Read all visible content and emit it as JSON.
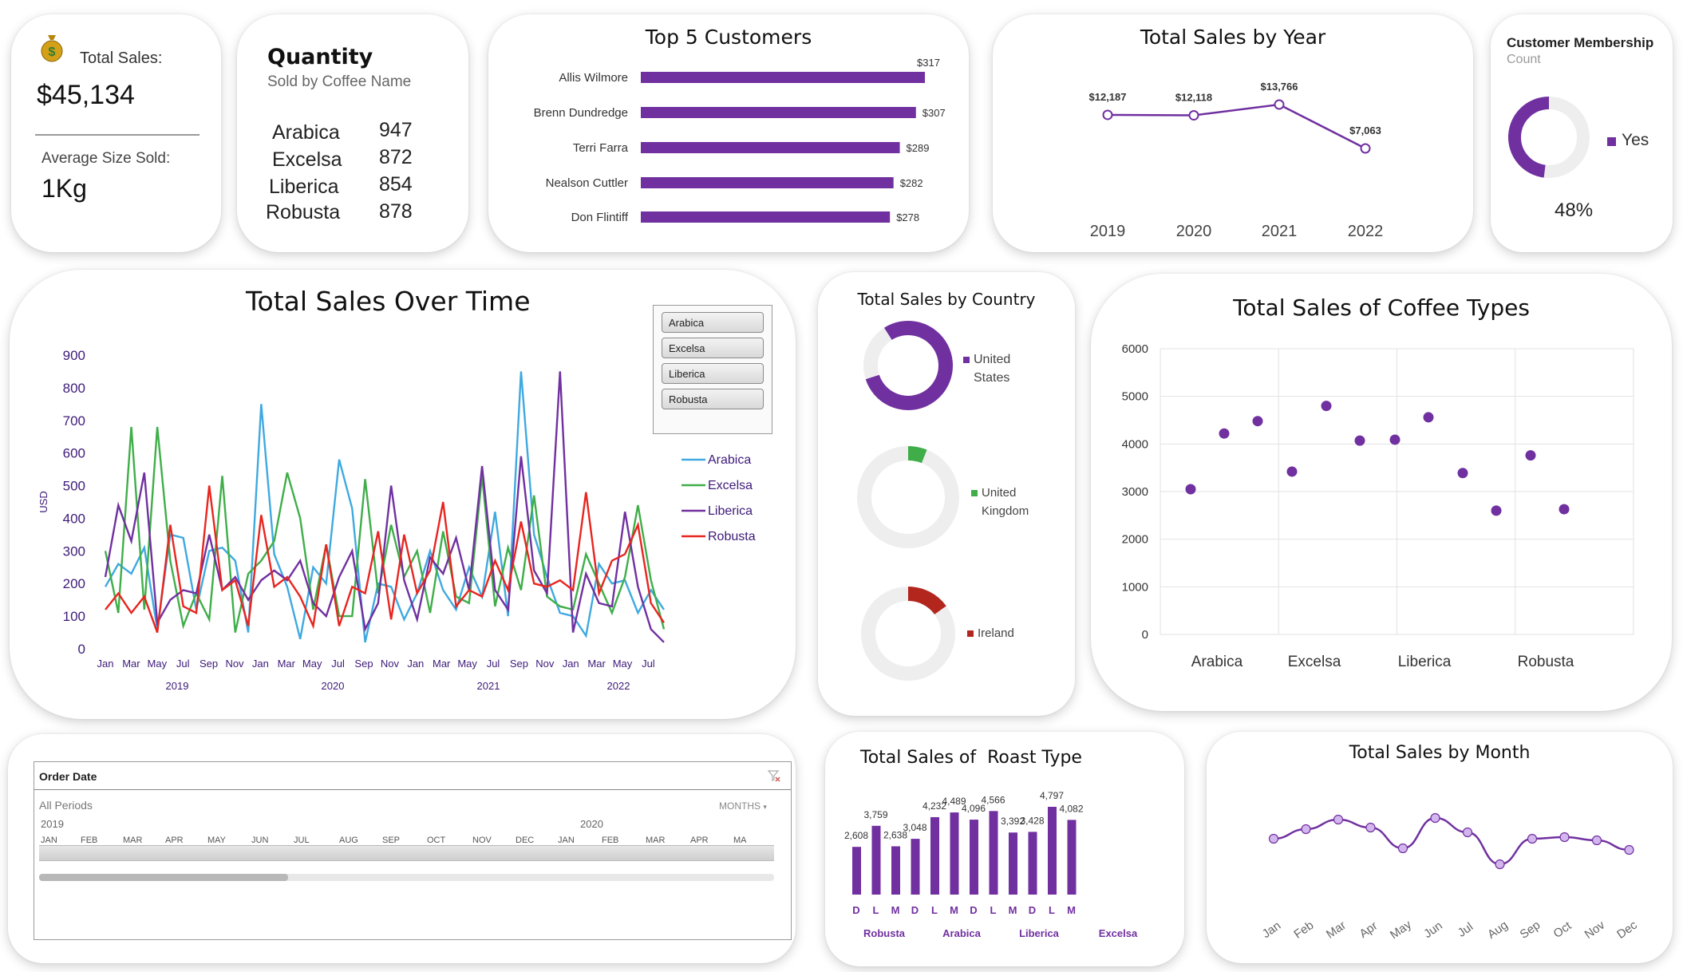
{
  "kpi": {
    "total_sales_label": "Total Sales:",
    "total_sales_value": "$45,134",
    "avg_size_label": "Average Size Sold:",
    "avg_size_value": "1Kg",
    "money_icon": "money-bag-icon"
  },
  "quantity": {
    "title": "Quantity",
    "subtitle": "Sold by Coffee Name",
    "rows": [
      {
        "name": "Arabica",
        "qty": "947"
      },
      {
        "name": "Excelsa",
        "qty": "872"
      },
      {
        "name": "Liberica",
        "qty": "854"
      },
      {
        "name": "Robusta",
        "qty": "878"
      }
    ]
  },
  "top_customers": {
    "title": "Top 5 Customers",
    "rows": [
      {
        "name": "Allis Wilmore",
        "label": "$317",
        "value": 317
      },
      {
        "name": "Brenn Dundredge",
        "label": "$307",
        "value": 307
      },
      {
        "name": "Terri Farra",
        "label": "$289",
        "value": 289
      },
      {
        "name": "Nealson Cuttler",
        "label": "$282",
        "value": 282
      },
      {
        "name": "Don Flintiff",
        "label": "$278",
        "value": 278
      }
    ]
  },
  "sales_by_year": {
    "title": "Total Sales by Year",
    "points": [
      {
        "year": "2019",
        "label": "$12,187",
        "value": 12187
      },
      {
        "year": "2020",
        "label": "$12,118",
        "value": 12118
      },
      {
        "year": "2021",
        "label": "$13,766",
        "value": 13766
      },
      {
        "year": "2022",
        "label": "$7,063",
        "value": 7063
      }
    ]
  },
  "membership": {
    "title": "Customer Membership",
    "subtitle": "Count",
    "legend": "Yes",
    "percent_label": "48%",
    "fraction": 0.48
  },
  "over_time": {
    "title": "Total Sales Over Time",
    "ylabel": "USD",
    "yticks": [
      "900",
      "800",
      "700",
      "600",
      "500",
      "400",
      "300",
      "200",
      "100",
      "0"
    ],
    "months": [
      "Jan",
      "Mar",
      "May",
      "Jul",
      "Sep",
      "Nov",
      "Jan",
      "Mar",
      "May",
      "Jul",
      "Sep",
      "Nov",
      "Jan",
      "Mar",
      "May",
      "Jul",
      "Sep",
      "Nov",
      "Jan",
      "Mar",
      "May",
      "Jul"
    ],
    "years": [
      "2019",
      "2020",
      "2021",
      "2022"
    ],
    "slicer": [
      "Arabica",
      "Excelsa",
      "Liberica",
      "Robusta"
    ],
    "legend": [
      "Arabica",
      "Excelsa",
      "Liberica",
      "Robusta"
    ]
  },
  "by_country": {
    "title": "Total Sales by Country",
    "items": [
      {
        "label_1": "United",
        "label_2": "States",
        "fraction": 0.79,
        "color": "#7030a0"
      },
      {
        "label_1": "United",
        "label_2": "Kingdom",
        "fraction": 0.06,
        "color": "#3fae49"
      },
      {
        "label_1": "Ireland",
        "label_2": "",
        "fraction": 0.15,
        "color": "#b3261e"
      }
    ]
  },
  "coffee_types": {
    "title": "Total Sales of Coffee Types",
    "yticks": [
      "6000",
      "5000",
      "4000",
      "3000",
      "2000",
      "1000",
      "0"
    ],
    "groups": [
      "Arabica",
      "Excelsa",
      "Liberica",
      "Robusta"
    ]
  },
  "order_date": {
    "title": "Order Date",
    "period": "All Periods",
    "level": "MONTHS",
    "year_1": "2019",
    "year_2": "2020",
    "months": [
      "JAN",
      "FEB",
      "MAR",
      "APR",
      "MAY",
      "JUN",
      "JUL",
      "AUG",
      "SEP",
      "OCT",
      "NOV",
      "DEC",
      "JAN",
      "FEB",
      "MAR",
      "APR",
      "MA"
    ]
  },
  "roast": {
    "title": "Total Sales of  Roast Type",
    "groups": [
      "Robusta",
      "Arabica",
      "Liberica",
      "Excelsa"
    ]
  },
  "by_month": {
    "title": "Total Sales by Month",
    "months": [
      "Jan",
      "Feb",
      "Mar",
      "Apr",
      "May",
      "Jun",
      "Jul",
      "Aug",
      "Sep",
      "Oct",
      "Nov",
      "Dec"
    ]
  },
  "chart_data": [
    {
      "type": "bar",
      "title": "Top 5 Customers",
      "categories": [
        "Allis Wilmore",
        "Brenn Dundredge",
        "Terri Farra",
        "Nealson Cuttler",
        "Don Flintiff"
      ],
      "values": [
        317,
        307,
        289,
        282,
        278
      ]
    },
    {
      "type": "line",
      "title": "Total Sales by Year",
      "categories": [
        "2019",
        "2020",
        "2021",
        "2022"
      ],
      "values": [
        12187,
        12118,
        13766,
        7063
      ]
    },
    {
      "type": "line",
      "title": "Total Sales Over Time",
      "ylabel": "USD",
      "ylim": [
        0,
        900
      ],
      "x": [
        "2019-01",
        "2019-02",
        "2019-03",
        "2019-04",
        "2019-05",
        "2019-06",
        "2019-07",
        "2019-08",
        "2019-09",
        "2019-10",
        "2019-11",
        "2019-12",
        "2020-01",
        "2020-02",
        "2020-03",
        "2020-04",
        "2020-05",
        "2020-06",
        "2020-07",
        "2020-08",
        "2020-09",
        "2020-10",
        "2020-11",
        "2020-12",
        "2021-01",
        "2021-02",
        "2021-03",
        "2021-04",
        "2021-05",
        "2021-06",
        "2021-07",
        "2021-08",
        "2021-09",
        "2021-10",
        "2021-11",
        "2021-12",
        "2022-01",
        "2022-02",
        "2022-03",
        "2022-04",
        "2022-05",
        "2022-06",
        "2022-07",
        "2022-08"
      ],
      "series": [
        {
          "name": "Arabica",
          "color": "#3fa9e0",
          "values": [
            190,
            260,
            230,
            310,
            60,
            350,
            340,
            120,
            300,
            310,
            270,
            50,
            750,
            290,
            190,
            30,
            250,
            200,
            580,
            430,
            20,
            200,
            190,
            90,
            170,
            300,
            180,
            120,
            250,
            160,
            420,
            100,
            850,
            350,
            220,
            110,
            100,
            40,
            260,
            200,
            210,
            110,
            180,
            120
          ]
        },
        {
          "name": "Excelsa",
          "color": "#3fae49",
          "values": [
            300,
            110,
            680,
            120,
            680,
            270,
            70,
            170,
            90,
            530,
            50,
            230,
            270,
            330,
            540,
            400,
            120,
            320,
            100,
            100,
            520,
            170,
            380,
            220,
            300,
            110,
            360,
            160,
            140,
            530,
            130,
            310,
            180,
            470,
            160,
            130,
            120,
            290,
            200,
            110,
            220,
            440,
            210,
            60
          ]
        },
        {
          "name": "Liberica",
          "color": "#7030a0",
          "values": [
            220,
            440,
            330,
            540,
            80,
            150,
            180,
            170,
            350,
            180,
            220,
            150,
            210,
            240,
            210,
            270,
            140,
            100,
            220,
            300,
            60,
            140,
            500,
            210,
            90,
            280,
            230,
            340,
            180,
            560,
            180,
            120,
            590,
            240,
            170,
            850,
            50,
            230,
            140,
            130,
            420,
            190,
            60,
            20
          ]
        },
        {
          "name": "Robusta",
          "color": "#e8251f",
          "values": [
            120,
            170,
            110,
            160,
            50,
            380,
            130,
            110,
            500,
            180,
            210,
            70,
            410,
            190,
            220,
            160,
            70,
            320,
            70,
            190,
            170,
            360,
            90,
            350,
            170,
            240,
            450,
            130,
            180,
            160,
            270,
            180,
            390,
            200,
            190,
            210,
            180,
            480,
            170,
            270,
            290,
            380,
            140,
            80
          ]
        }
      ]
    },
    {
      "type": "pie",
      "title": "Total Sales by Country",
      "categories": [
        "United States",
        "United Kingdom",
        "Ireland"
      ],
      "values": [
        0.79,
        0.06,
        0.15
      ]
    },
    {
      "type": "pie",
      "title": "Customer Membership",
      "categories": [
        "Yes"
      ],
      "values": [
        0.48
      ]
    },
    {
      "type": "scatter",
      "title": "Total Sales of Coffee Types",
      "ylim": [
        0,
        6000
      ],
      "categories": [
        "Arabica",
        "Excelsa",
        "Liberica",
        "Robusta"
      ],
      "values": [
        3050,
        4220,
        4480,
        3420,
        4800,
        4070,
        4090,
        4560,
        3390,
        2600,
        3760,
        2630
      ]
    },
    {
      "type": "bar",
      "title": "Total Sales of  Roast Type",
      "groups": [
        "Robusta",
        "Arabica",
        "Liberica",
        "Excelsa"
      ],
      "categories": [
        "D",
        "L",
        "M",
        "D",
        "L",
        "M",
        "D",
        "L",
        "M",
        "D",
        "L",
        "M"
      ],
      "labels": [
        "2,608",
        "3,759",
        "2,638",
        "3,048",
        "4,232",
        "4,489",
        "4,096",
        "4,566",
        "3,392",
        "3,428",
        "4,797",
        "4,082"
      ],
      "values": [
        2608,
        3759,
        2638,
        3048,
        4232,
        4489,
        4096,
        4566,
        3392,
        3428,
        4797,
        4082
      ]
    },
    {
      "type": "line",
      "title": "Total Sales by Month",
      "categories": [
        "Jan",
        "Feb",
        "Mar",
        "Apr",
        "May",
        "Jun",
        "Jul",
        "Aug",
        "Sep",
        "Oct",
        "Nov",
        "Dec"
      ],
      "values": [
        3700,
        4000,
        4300,
        4050,
        3400,
        4350,
        3900,
        2900,
        3700,
        3750,
        3650,
        3350
      ]
    }
  ]
}
